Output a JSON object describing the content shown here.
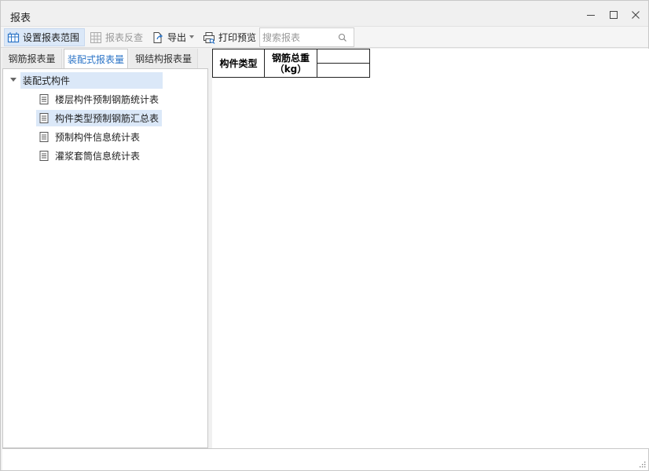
{
  "window": {
    "title": "报表",
    "controls": [
      "minimize-icon",
      "maximize-icon",
      "close-icon"
    ]
  },
  "toolbar": {
    "set_range_label": "设置报表范围",
    "reverse_check_label": "报表反查",
    "export_label": "导出",
    "print_preview_label": "打印预览",
    "search_placeholder": "搜索报表"
  },
  "tabs": [
    {
      "label": "钢筋报表量",
      "active": false
    },
    {
      "label": "装配式报表量",
      "active": true
    },
    {
      "label": "钢结构报表量",
      "active": false
    }
  ],
  "tree": {
    "root_label": "装配式构件",
    "items": [
      {
        "label": "楼层构件预制钢筋统计表",
        "selected": false
      },
      {
        "label": "构件类型预制钢筋汇总表",
        "selected": true
      },
      {
        "label": "预制构件信息统计表",
        "selected": false
      },
      {
        "label": "灌浆套筒信息统计表",
        "selected": false
      }
    ]
  },
  "report": {
    "col_type": "构件类型",
    "col_weight_line1": "钢筋总重",
    "col_weight_line2": "（kg）"
  },
  "colors": {
    "accent": "#2b74c7",
    "selection": "#dbe8f8"
  }
}
